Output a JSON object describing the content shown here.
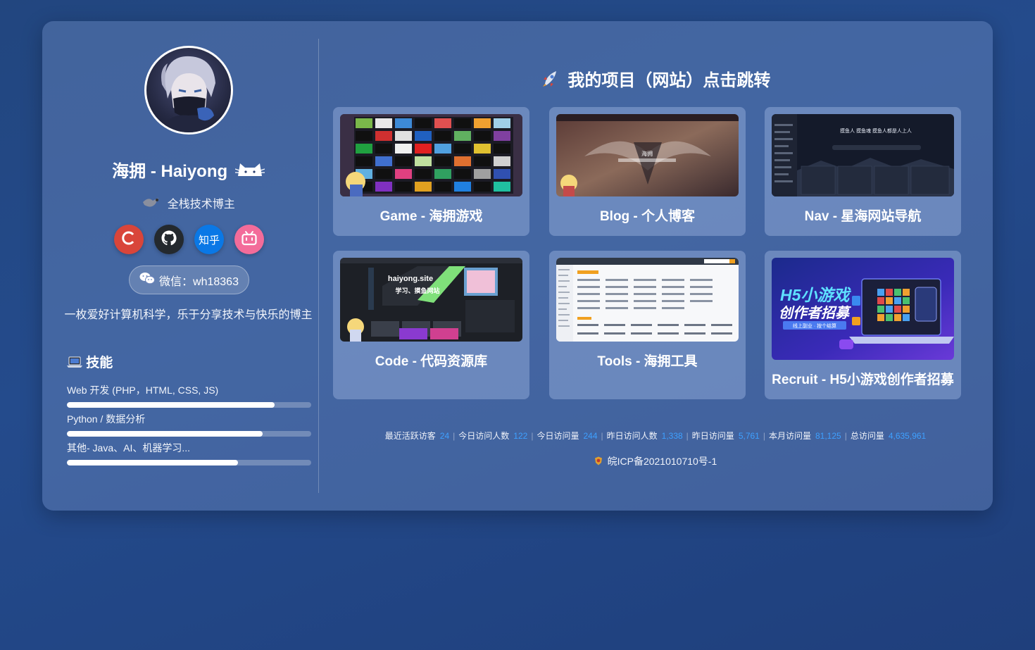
{
  "profile": {
    "name": "海拥 - Haiyong",
    "subtitle": "全栈技术博主",
    "wechat": "微信：wh18363",
    "bio": "一枚爱好计算机科学，乐于分享技术与快乐的博主",
    "socials": [
      {
        "icon": "csdn-icon",
        "label": "C"
      },
      {
        "icon": "github-icon",
        "label": ""
      },
      {
        "icon": "zhihu-icon",
        "label": "知乎"
      },
      {
        "icon": "bilibili-icon",
        "label": ""
      }
    ]
  },
  "skills": {
    "title": "技能",
    "items": [
      {
        "label": "Web 开发 (PHP，HTML, CSS, JS)",
        "level": 0.85
      },
      {
        "label": "Python / 数据分析",
        "level": 0.8
      },
      {
        "label": "其他- Java、AI、机器学习...",
        "level": 0.7
      }
    ]
  },
  "projects": {
    "title": "我的项目（网站）点击跳转",
    "items": [
      {
        "name": "Game - 海拥游戏"
      },
      {
        "name": "Blog - 个人博客"
      },
      {
        "name": "Nav - 星海网站导航"
      },
      {
        "name": "Code - 代码资源库"
      },
      {
        "name": "Tools - 海拥工具"
      },
      {
        "name": "Recruit - H5小游戏创作者招募"
      }
    ]
  },
  "stats": {
    "items": [
      {
        "label": "最近活跃访客",
        "value": "24"
      },
      {
        "label": "今日访问人数",
        "value": "122"
      },
      {
        "label": "今日访问量",
        "value": "244"
      },
      {
        "label": "昨日访问人数",
        "value": "1,338"
      },
      {
        "label": "昨日访问量",
        "value": "5,761"
      },
      {
        "label": "本月访问量",
        "value": "81,125"
      },
      {
        "label": "总访问量",
        "value": "4,635,961"
      }
    ]
  },
  "icp": "皖ICP备2021010710号-1",
  "thumbs": {
    "code_site": "haiyong.site",
    "code_slogan": "学习、摸鱼网站",
    "nav_banner": "摸鱼人 摸鱼魂 摸鱼人都是人上人",
    "recruit_line1": "H5小游戏",
    "recruit_line2": "创作者招募",
    "recruit_sub": "线上副业 · 按个结算",
    "blog_title": "海拥"
  },
  "colors": {
    "accent_number": "#3ea0ff",
    "csdn": "#d9453a",
    "github": "#24292e",
    "zhihu": "#0a78e6",
    "bilibili": "#f36c9a"
  }
}
